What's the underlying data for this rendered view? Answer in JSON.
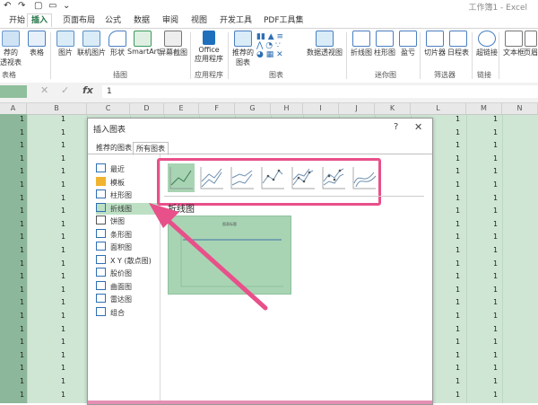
{
  "app": {
    "title": "工作簿1 - Excel"
  },
  "colors": {
    "accent": "#217346",
    "arrow": "#e8508a",
    "selected_cells": "#cfe6d4"
  },
  "tabs": [
    "开始",
    "插入",
    "页面布局",
    "公式",
    "数据",
    "审阅",
    "视图",
    "开发工具",
    "PDF工具集"
  ],
  "active_tab": "插入",
  "ribbon": {
    "left_labels": [
      "荐的",
      "透视表",
      "表格"
    ],
    "buttons": [
      "表格",
      "图片",
      "联机图片",
      "形状",
      "SmartArt",
      "屏幕截图",
      "Office",
      "应用程序",
      "推荐的",
      "图表",
      "数据透视图",
      "折线图",
      "柱形图",
      "盈亏",
      "切片器",
      "日程表",
      "超链接",
      "文本框",
      "页眉"
    ],
    "groups": [
      "表格",
      "插图",
      "应用程序",
      "图表",
      "迷你图",
      "筛选器",
      "链接"
    ]
  },
  "formula_bar": {
    "name_box": "",
    "fx": "fx",
    "content": "1",
    "cancel": "✕",
    "ok": "✓"
  },
  "columns": [
    "A",
    "B",
    "C",
    "D",
    "E",
    "F",
    "G",
    "H",
    "I",
    "J",
    "K",
    "L",
    "M",
    "N"
  ],
  "cell_value": "1",
  "dialog": {
    "title": "插入图表",
    "help": "?",
    "close": "✕",
    "tabs": [
      "推荐的图表",
      "所有图表"
    ],
    "active_tab": "所有图表",
    "chart_types": [
      "最近",
      "模板",
      "柱形图",
      "折线图",
      "饼图",
      "条形图",
      "面积图",
      "X Y (散点图)",
      "股价图",
      "曲面图",
      "雷达图",
      "组合"
    ],
    "selected_type": "折线图",
    "section_title": "折线图",
    "preview_title": "图表标题",
    "subtype_icons": [
      "line-icon",
      "stacked-line-icon",
      "percent-stacked-line-icon",
      "line-with-markers-icon",
      "stacked-line-markers-icon",
      "percent-stacked-markers-icon",
      "3d-line-icon"
    ]
  }
}
